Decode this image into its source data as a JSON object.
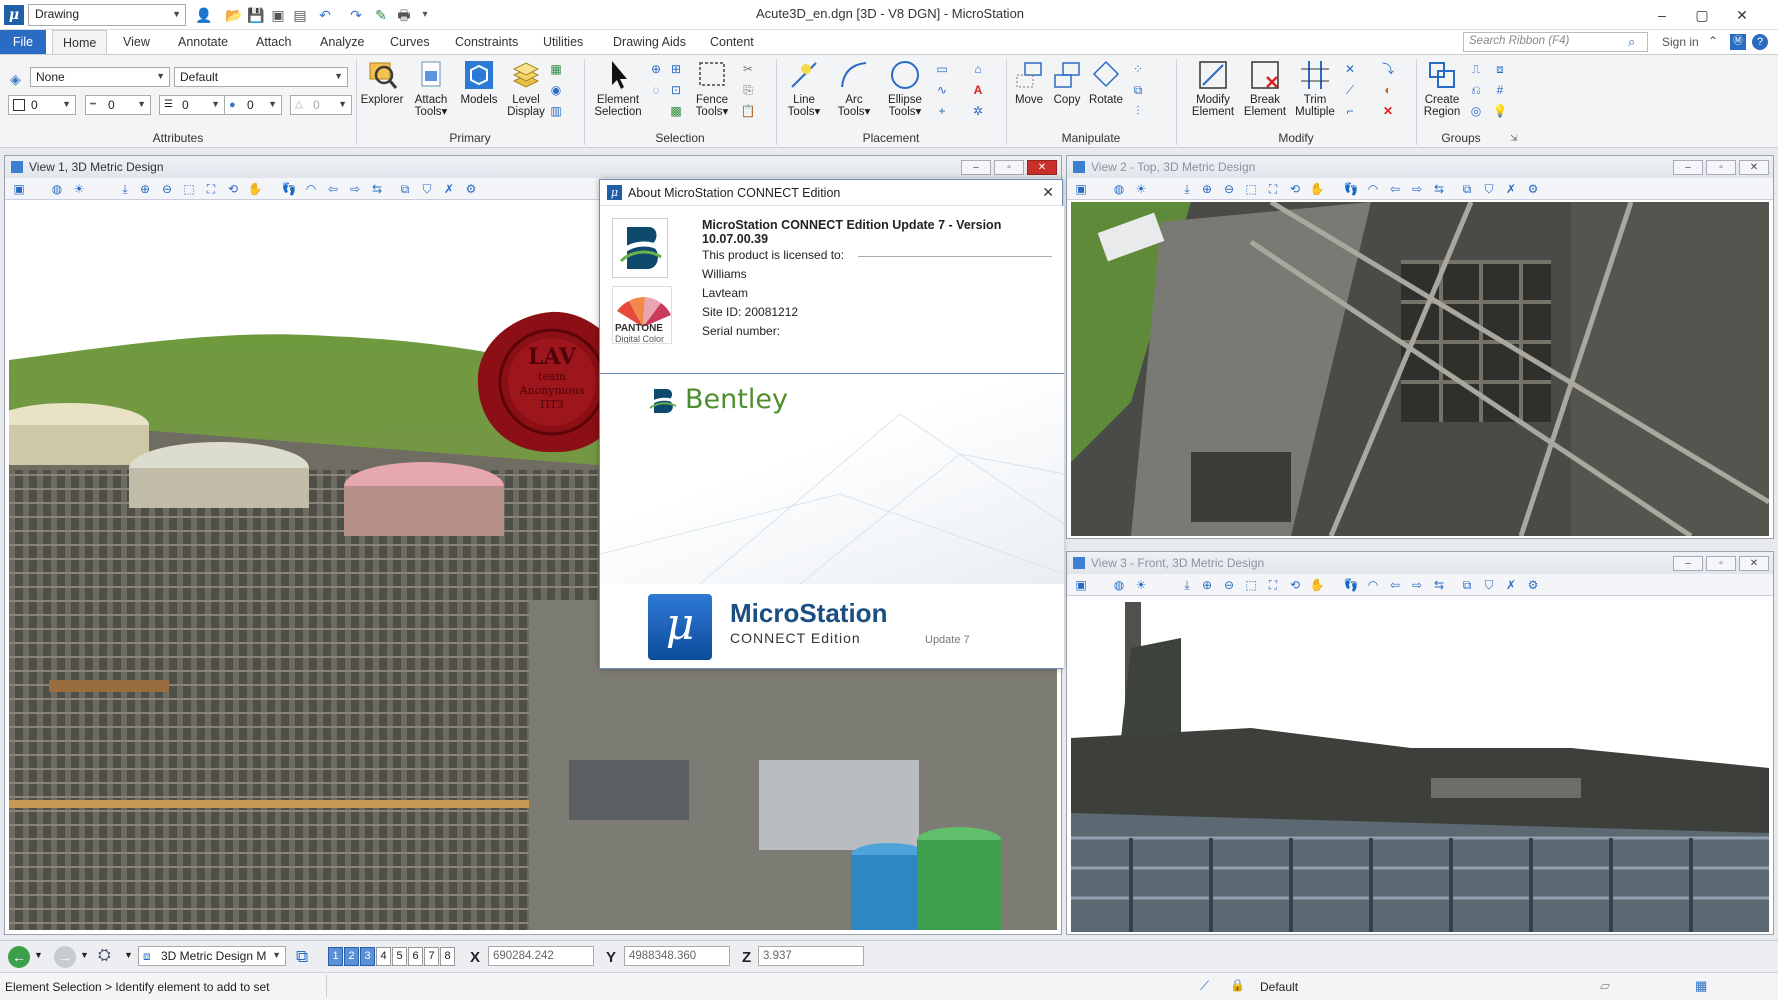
{
  "titlebar": {
    "workspace": "Drawing",
    "window_title": "Acute3D_en.dgn [3D - V8 DGN] - MicroStation"
  },
  "tabs": [
    "File",
    "Home",
    "View",
    "Annotate",
    "Attach",
    "Analyze",
    "Curves",
    "Constraints",
    "Utilities",
    "Drawing Aids",
    "Content"
  ],
  "search": {
    "placeholder": "Search Ribbon (F4)"
  },
  "signin": "Sign in",
  "attributes": {
    "level": "None",
    "style": "Default",
    "color": "0",
    "weight": "0",
    "linestyle": "0",
    "fill": "0",
    "transparency": "0"
  },
  "ribbon": {
    "groups": {
      "attributes": "Attributes",
      "primary": "Primary",
      "selection": "Selection",
      "placement": "Placement",
      "manipulate": "Manipulate",
      "modify": "Modify",
      "groups": "Groups"
    },
    "buttons": {
      "explorer": "Explorer",
      "attach_tools_1": "Attach",
      "attach_tools_2": "Tools",
      "models": "Models",
      "level_display_1": "Level",
      "level_display_2": "Display",
      "element_selection_1": "Element",
      "element_selection_2": "Selection",
      "fence_tools_1": "Fence",
      "fence_tools_2": "Tools",
      "line_tools_1": "Line",
      "line_tools_2": "Tools",
      "arc_tools_1": "Arc",
      "arc_tools_2": "Tools",
      "ellipse_tools_1": "Ellipse",
      "ellipse_tools_2": "Tools",
      "move": "Move",
      "copy": "Copy",
      "rotate": "Rotate",
      "modify_element_1": "Modify",
      "modify_element_2": "Element",
      "break_element_1": "Break",
      "break_element_2": "Element",
      "trim_multiple_1": "Trim",
      "trim_multiple_2": "Multiple",
      "create_region_1": "Create",
      "create_region_2": "Region"
    }
  },
  "views": {
    "view1": "View 1, 3D Metric Design",
    "view2": "View 2 - Top, 3D Metric Design",
    "view3": "View 3 - Front, 3D Metric Design"
  },
  "about": {
    "title": "About MicroStation CONNECT Edition",
    "version": "MicroStation CONNECT Edition Update 7 - Version 10.07.00.39",
    "licensed_to": "This product is licensed to:",
    "name": "Williams",
    "company": "Lavteam",
    "site_id": "Site ID: 20081212",
    "serial": "Serial number:",
    "pantone": "PANTONE",
    "pantone_sub": "Digital Color",
    "bentley": "Bentley",
    "brand": "MicroStation",
    "edition": "CONNECT Edition",
    "update": "Update 7"
  },
  "seal": {
    "line1": "LAV",
    "line2": "team",
    "line3": "Anonymous",
    "line4": "ПТЗ"
  },
  "coords": {
    "model": "3D Metric Design M",
    "view_numbers": [
      "1",
      "2",
      "3",
      "4",
      "5",
      "6",
      "7",
      "8"
    ],
    "x_label": "X",
    "x": "690284.242",
    "y_label": "Y",
    "y": "4988348.360",
    "z_label": "Z",
    "z": "3.937"
  },
  "status": {
    "prompt": "Element Selection > Identify element to add to set",
    "level": "Default"
  },
  "colors": {
    "accent": "#2a6cc4",
    "dialog_border": "#6c8fbf",
    "seal": "#8b0f14"
  }
}
